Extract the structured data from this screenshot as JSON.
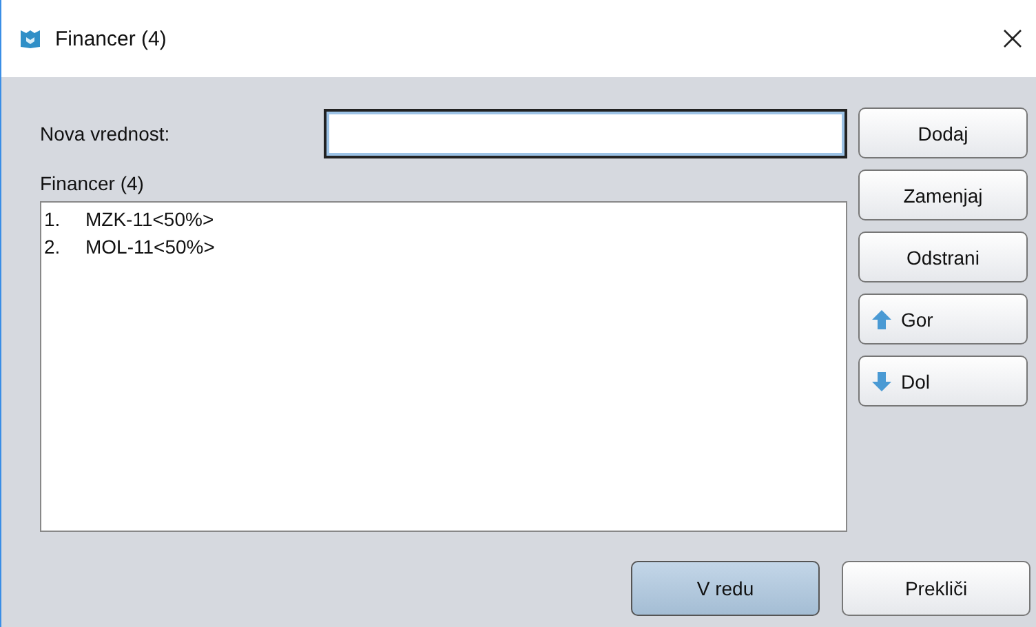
{
  "window": {
    "title": "Financer (4)"
  },
  "field": {
    "label": "Nova vrednost:"
  },
  "list": {
    "label": "Financer (4)",
    "items": [
      {
        "number": "1.",
        "text": "MZK-11<50%>"
      },
      {
        "number": "2.",
        "text": "MOL-11<50%>"
      }
    ]
  },
  "side_buttons": [
    {
      "label": "Dodaj",
      "kind": "text"
    },
    {
      "label": "Zamenjaj",
      "kind": "text"
    },
    {
      "label": "Odstrani",
      "kind": "text"
    },
    {
      "label": "Gor",
      "kind": "up"
    },
    {
      "label": "Dol",
      "kind": "down"
    }
  ],
  "footer_buttons": [
    {
      "label": "V redu",
      "default": true
    },
    {
      "label": "Prekliči",
      "default": false
    }
  ]
}
